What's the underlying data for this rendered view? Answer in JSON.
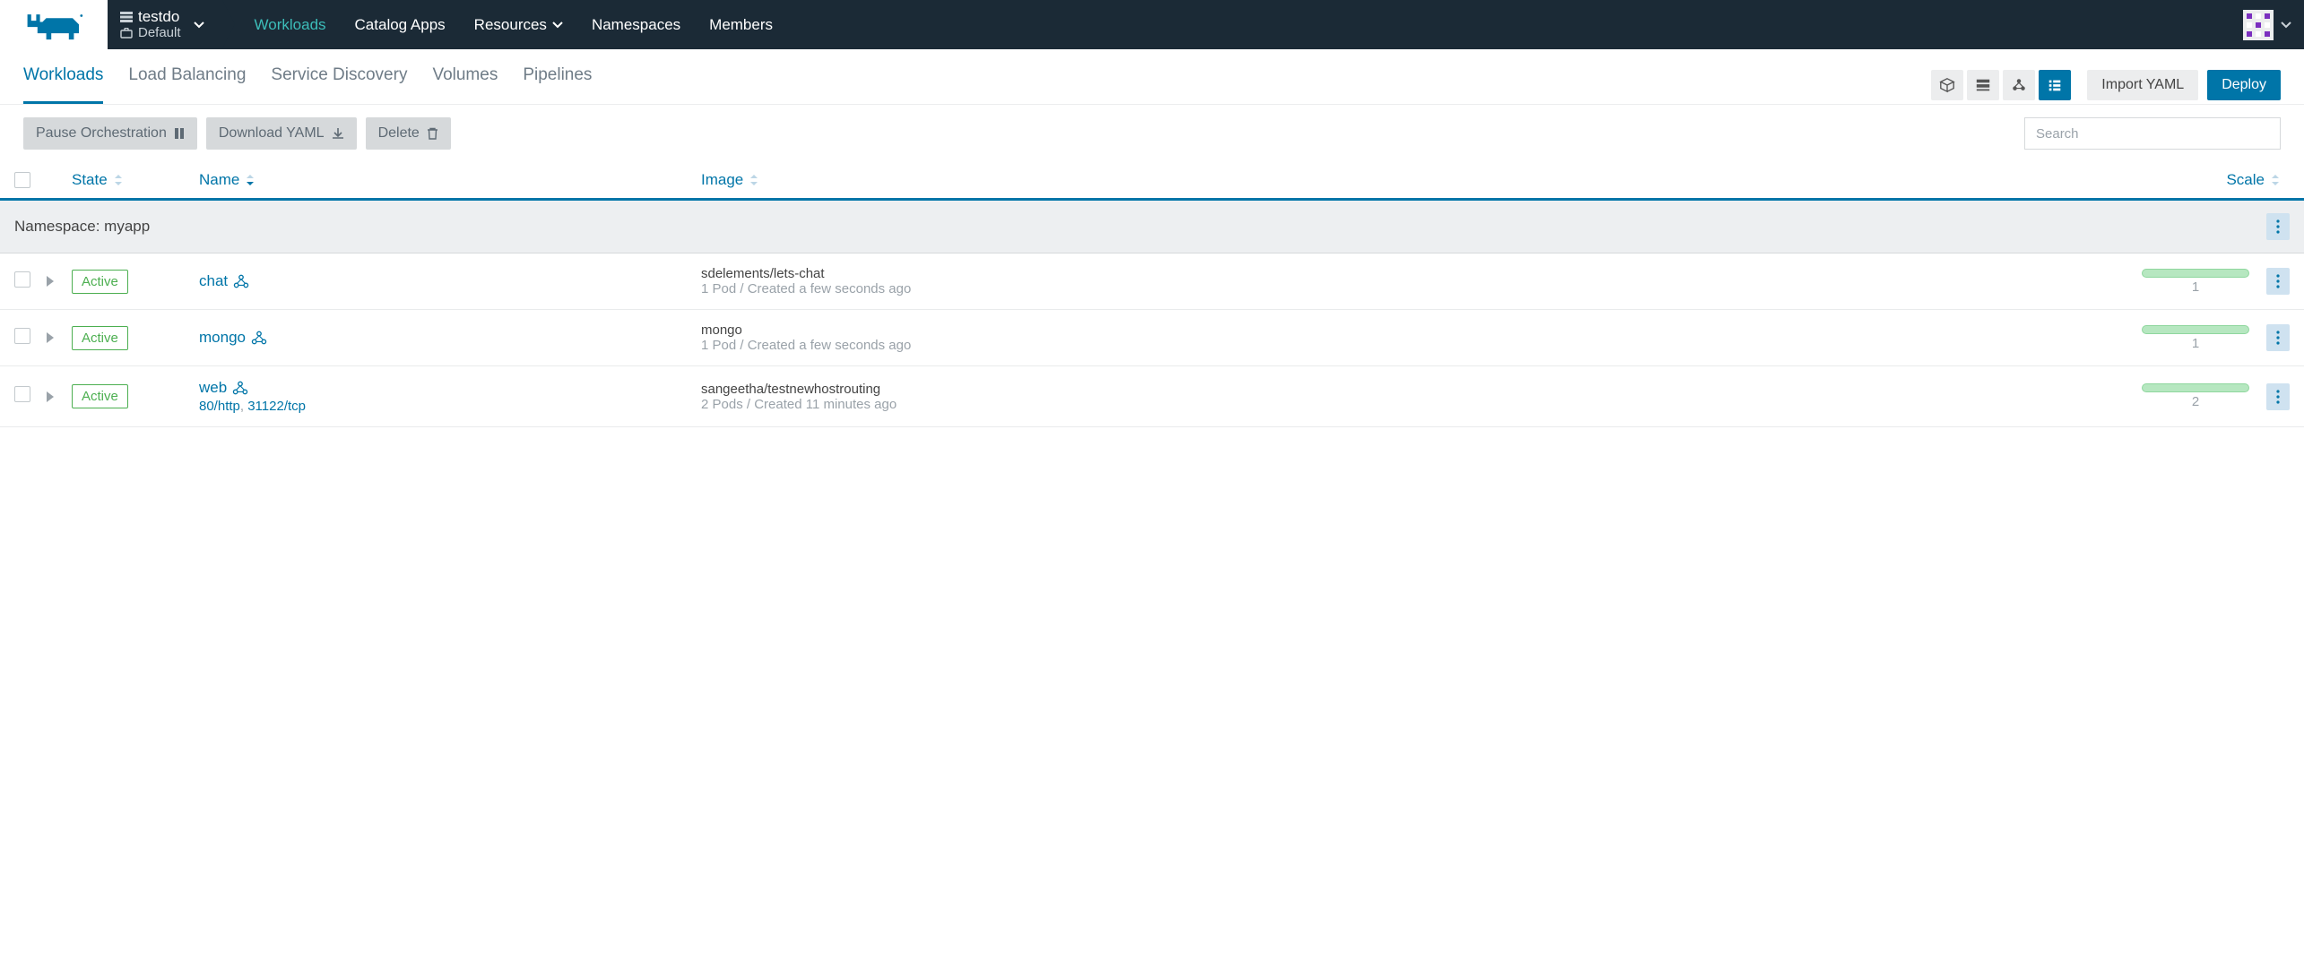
{
  "topnav": {
    "cluster_name": "testdo",
    "cluster_scope": "Default",
    "links": [
      "Workloads",
      "Catalog Apps",
      "Resources",
      "Namespaces",
      "Members"
    ]
  },
  "subtabs": [
    "Workloads",
    "Load Balancing",
    "Service Discovery",
    "Volumes",
    "Pipelines"
  ],
  "buttons": {
    "import_yaml": "Import YAML",
    "deploy": "Deploy",
    "pause": "Pause Orchestration",
    "download": "Download YAML",
    "delete": "Delete"
  },
  "search_placeholder": "Search",
  "columns": {
    "state": "State",
    "name": "Name",
    "image": "Image",
    "scale": "Scale"
  },
  "namespace_label": "Namespace: myapp",
  "rows": [
    {
      "state": "Active",
      "name": "chat",
      "ports": [],
      "image": "sdelements/lets-chat",
      "meta": "1 Pod / Created a few seconds ago",
      "scale": "1"
    },
    {
      "state": "Active",
      "name": "mongo",
      "ports": [],
      "image": "mongo",
      "meta": "1 Pod / Created a few seconds ago",
      "scale": "1"
    },
    {
      "state": "Active",
      "name": "web",
      "ports": [
        "80/http",
        "31122/tcp"
      ],
      "image": "sangeetha/testnewhostrouting",
      "meta": "2 Pods / Created 11 minutes ago",
      "scale": "2"
    }
  ]
}
